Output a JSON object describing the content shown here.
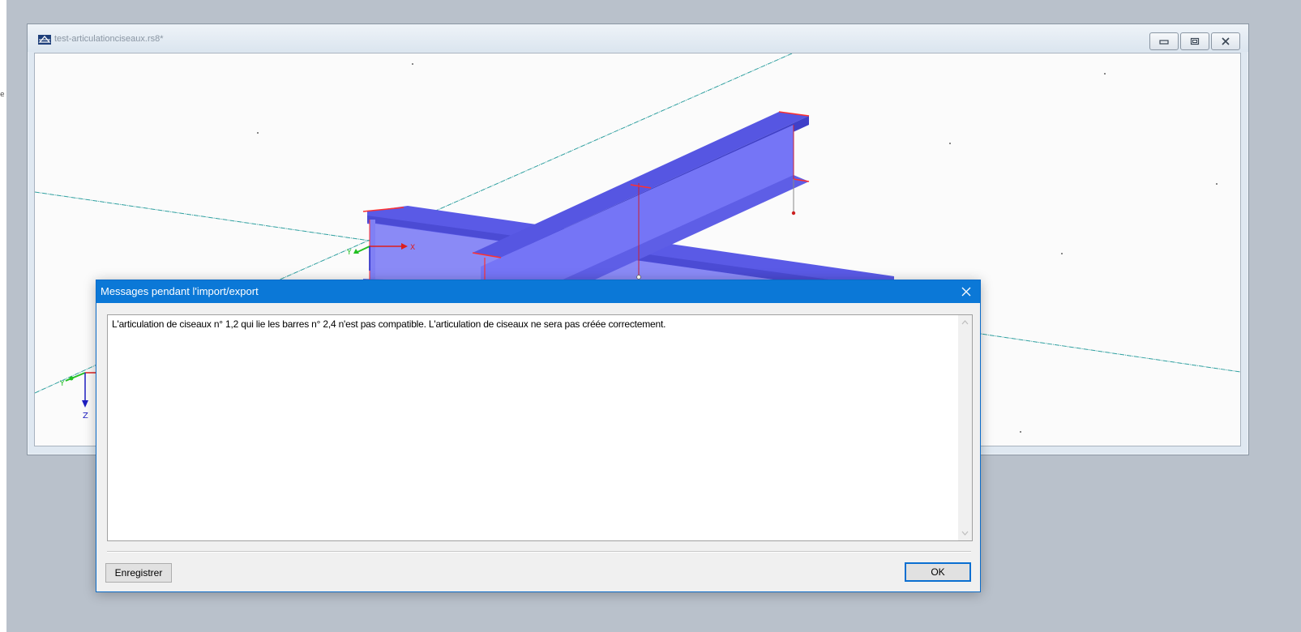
{
  "mdi_window": {
    "title": "test-articulationciseaux.rs8*",
    "icon": "rfem-app-icon",
    "controls": [
      "minimize-icon",
      "restore-icon",
      "close-icon"
    ]
  },
  "viewport": {
    "axis_labels": {
      "x": "X",
      "y": "Y",
      "z": "Z"
    },
    "colors": {
      "background": "#fbfbfb",
      "beam_fill": "#6f6ff5",
      "beam_edge": "#ff3030",
      "grid_line": "#2fa0a0"
    }
  },
  "dialog": {
    "title": "Messages pendant l'import/export",
    "message": "L'articulation de ciseaux n° 1,2 qui lie les barres n° 2,4 n'est pas compatible. L'articulation de ciseaux ne sera pas créée correctement.",
    "save_label": "Enregistrer",
    "ok_label": "OK",
    "accent_color": "#0b78d7"
  }
}
